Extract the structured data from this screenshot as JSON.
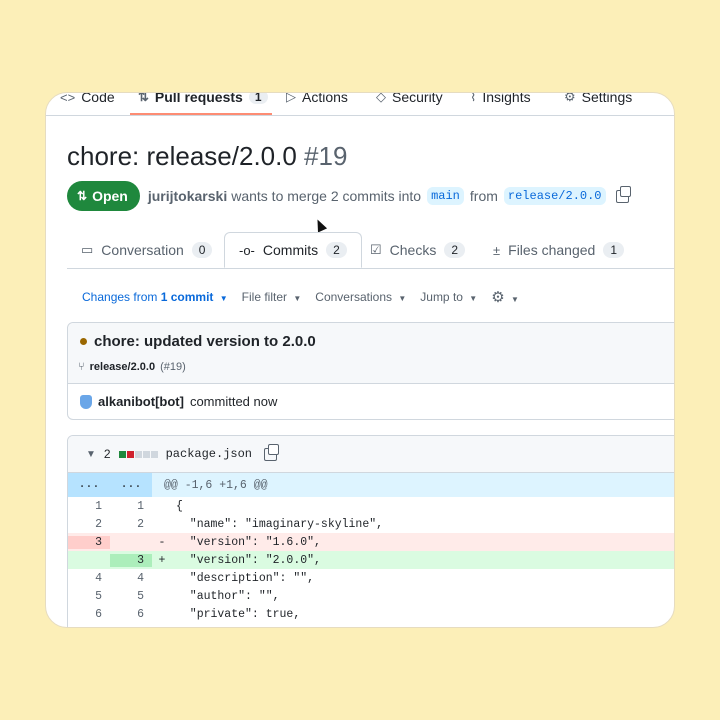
{
  "repo_nav": {
    "items": [
      {
        "label": "Code",
        "icon": "code-icon"
      },
      {
        "label": "Pull requests",
        "icon": "pull-request-icon",
        "count": "1"
      },
      {
        "label": "Actions",
        "icon": "play-icon"
      },
      {
        "label": "Security",
        "icon": "shield-icon"
      },
      {
        "label": "Insights",
        "icon": "graph-icon"
      },
      {
        "label": "Settings",
        "icon": "gear-icon"
      }
    ]
  },
  "pr": {
    "title": "chore: release/2.0.0",
    "number": "#19",
    "state": "Open",
    "author": "jurijtokarski",
    "merge_text": "wants to merge 2 commits into",
    "base_branch": "main",
    "from_text": "from",
    "head_branch": "release/2.0.0"
  },
  "tabs": [
    {
      "label": "Conversation",
      "count": "0",
      "icon": "comment-icon"
    },
    {
      "label": "Commits",
      "count": "2",
      "icon": "commit-icon"
    },
    {
      "label": "Checks",
      "count": "2",
      "icon": "checklist-icon"
    },
    {
      "label": "Files changed",
      "count": "1",
      "icon": "file-diff-icon"
    }
  ],
  "toolbar": {
    "changes_from_prefix": "Changes from",
    "changes_from_value": "1 commit",
    "file_filter": "File filter",
    "conversations": "Conversations",
    "jump_to": "Jump to"
  },
  "commit": {
    "message": "chore: updated version to 2.0.0",
    "branch": "release/2.0.0",
    "pr_ref": "(#19)",
    "committer": "alkanibot[bot]",
    "committed_text": "committed now"
  },
  "diff": {
    "changed_count": "2",
    "filename": "package.json",
    "hunk_header": "@@ -1,6 +1,6 @@",
    "hunk_left": "...",
    "hunk_right": "...",
    "lines": [
      {
        "old": "1",
        "new": "1",
        "marker": "",
        "text": "{"
      },
      {
        "old": "2",
        "new": "2",
        "marker": "",
        "text": "  \"name\": \"imaginary-skyline\","
      },
      {
        "old": "3",
        "new": "",
        "marker": "-",
        "text": "  \"version\": \"1.6.0\","
      },
      {
        "old": "",
        "new": "3",
        "marker": "+",
        "text": "  \"version\": \"2.0.0\","
      },
      {
        "old": "4",
        "new": "4",
        "marker": "",
        "text": "  \"description\": \"\","
      },
      {
        "old": "5",
        "new": "5",
        "marker": "",
        "text": "  \"author\": \"\","
      },
      {
        "old": "6",
        "new": "6",
        "marker": "",
        "text": "  \"private\": true,"
      }
    ]
  },
  "colors": {
    "open_green": "#1f883d",
    "link_blue": "#0969da",
    "background": "#fcefb8",
    "tab_underline": "#fd8c73"
  }
}
